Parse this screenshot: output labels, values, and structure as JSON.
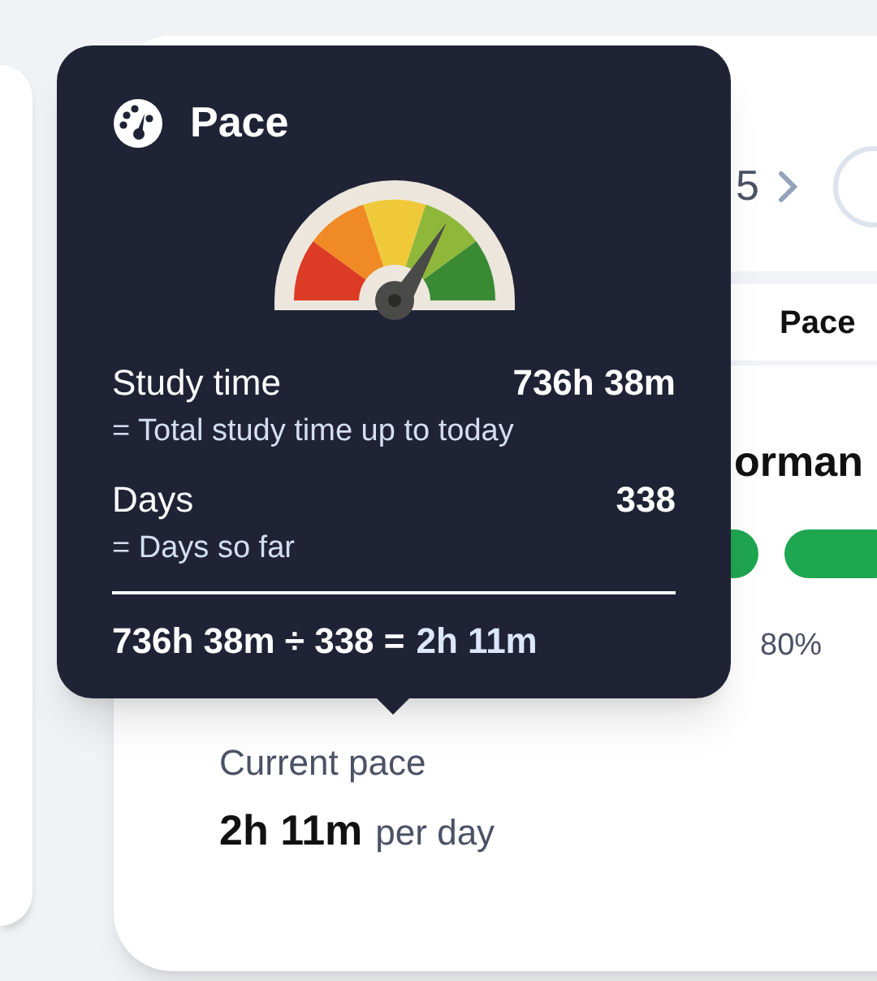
{
  "tooltip": {
    "title": "Pace",
    "rows": [
      {
        "label": "Study time",
        "value": "736h 38m",
        "note": "= Total study time up to today"
      },
      {
        "label": "Days",
        "value": "338",
        "note": "= Days so far"
      }
    ],
    "formula": "736h 38m ÷ 338 =",
    "result": "2h 11m"
  },
  "card": {
    "counter": "5",
    "tab": "Pace",
    "heading": "orman",
    "percent": "80%",
    "current_label": "Current pace",
    "current_value": "2h 11m",
    "current_unit": "per day"
  }
}
